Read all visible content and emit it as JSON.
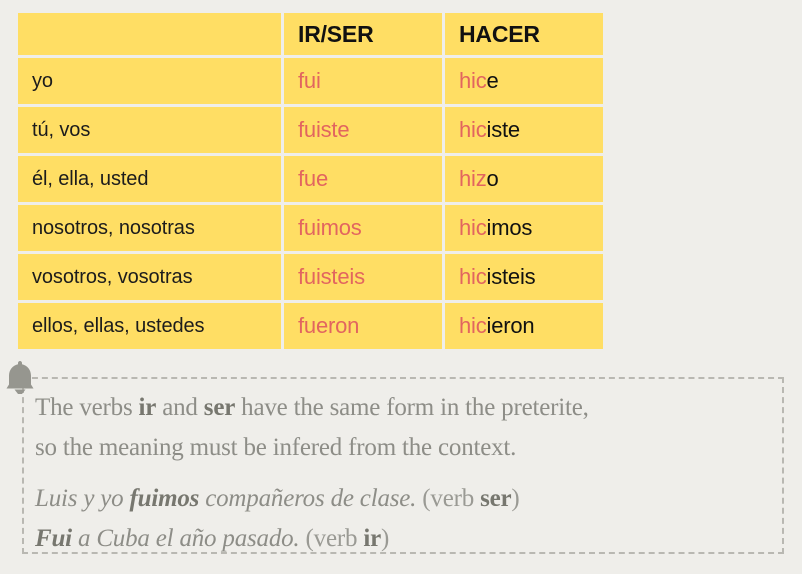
{
  "colors": {
    "page_background": "#EFEEEA",
    "table_cell": "#FFDE64",
    "stem_accent": "#E2655F",
    "ending_text": "#111111",
    "note_text": "#8D8D87",
    "note_border": "#B9B8B2",
    "bell_icon": "#96968F"
  },
  "table": {
    "headers": {
      "pronoun": "",
      "ir_ser": "IR/SER",
      "hacer": "HACER"
    },
    "rows": [
      {
        "pronoun": "yo",
        "ir_ser": {
          "full": "fui",
          "stem": "fui",
          "ending": ""
        },
        "hacer": {
          "full": "hice",
          "stem": "hic",
          "ending": "e"
        }
      },
      {
        "pronoun": "tú, vos",
        "ir_ser": {
          "full": "fuiste",
          "stem": "fuiste",
          "ending": ""
        },
        "hacer": {
          "full": "hiciste",
          "stem": "hic",
          "ending": "iste"
        }
      },
      {
        "pronoun": "él, ella, usted",
        "ir_ser": {
          "full": "fue",
          "stem": "fue",
          "ending": ""
        },
        "hacer": {
          "full": "hizo",
          "stem": "hiz",
          "ending": "o"
        }
      },
      {
        "pronoun": "nosotros, nosotras",
        "ir_ser": {
          "full": "fuimos",
          "stem": "fuimos",
          "ending": ""
        },
        "hacer": {
          "full": "hicimos",
          "stem": "hic",
          "ending": "imos"
        }
      },
      {
        "pronoun": "vosotros, vosotras",
        "ir_ser": {
          "full": "fuisteis",
          "stem": "fuisteis",
          "ending": ""
        },
        "hacer": {
          "full": "hicisteis",
          "stem": "hic",
          "ending": "isteis"
        }
      },
      {
        "pronoun": "ellos, ellas, ustedes",
        "ir_ser": {
          "full": "fueron",
          "stem": "fueron",
          "ending": ""
        },
        "hacer": {
          "full": "hicieron",
          "stem": "hic",
          "ending": "ieron"
        }
      }
    ]
  },
  "note": {
    "icon": "bell-icon",
    "paragraph": {
      "line1_part1": "The verbs ",
      "line1_bold1": "ir",
      "line1_part2": " and ",
      "line1_bold2": "ser",
      "line1_part3": " have the same form in the preterite,",
      "line2": "so the meaning must be infered from the context."
    },
    "examples": [
      {
        "bold_lead": "",
        "sentence_pre": "Luis y yo ",
        "sentence_bold": "fuimos",
        "sentence_post": " compañeros de clase.",
        "tag_pre": " (verb ",
        "tag_bold": "ser",
        "tag_post": ")"
      },
      {
        "bold_lead": "Fui",
        "sentence_pre": "",
        "sentence_bold": "",
        "sentence_post": " a Cuba el año pasado.",
        "tag_pre": " (verb ",
        "tag_bold": "ir",
        "tag_post": ")"
      }
    ]
  }
}
